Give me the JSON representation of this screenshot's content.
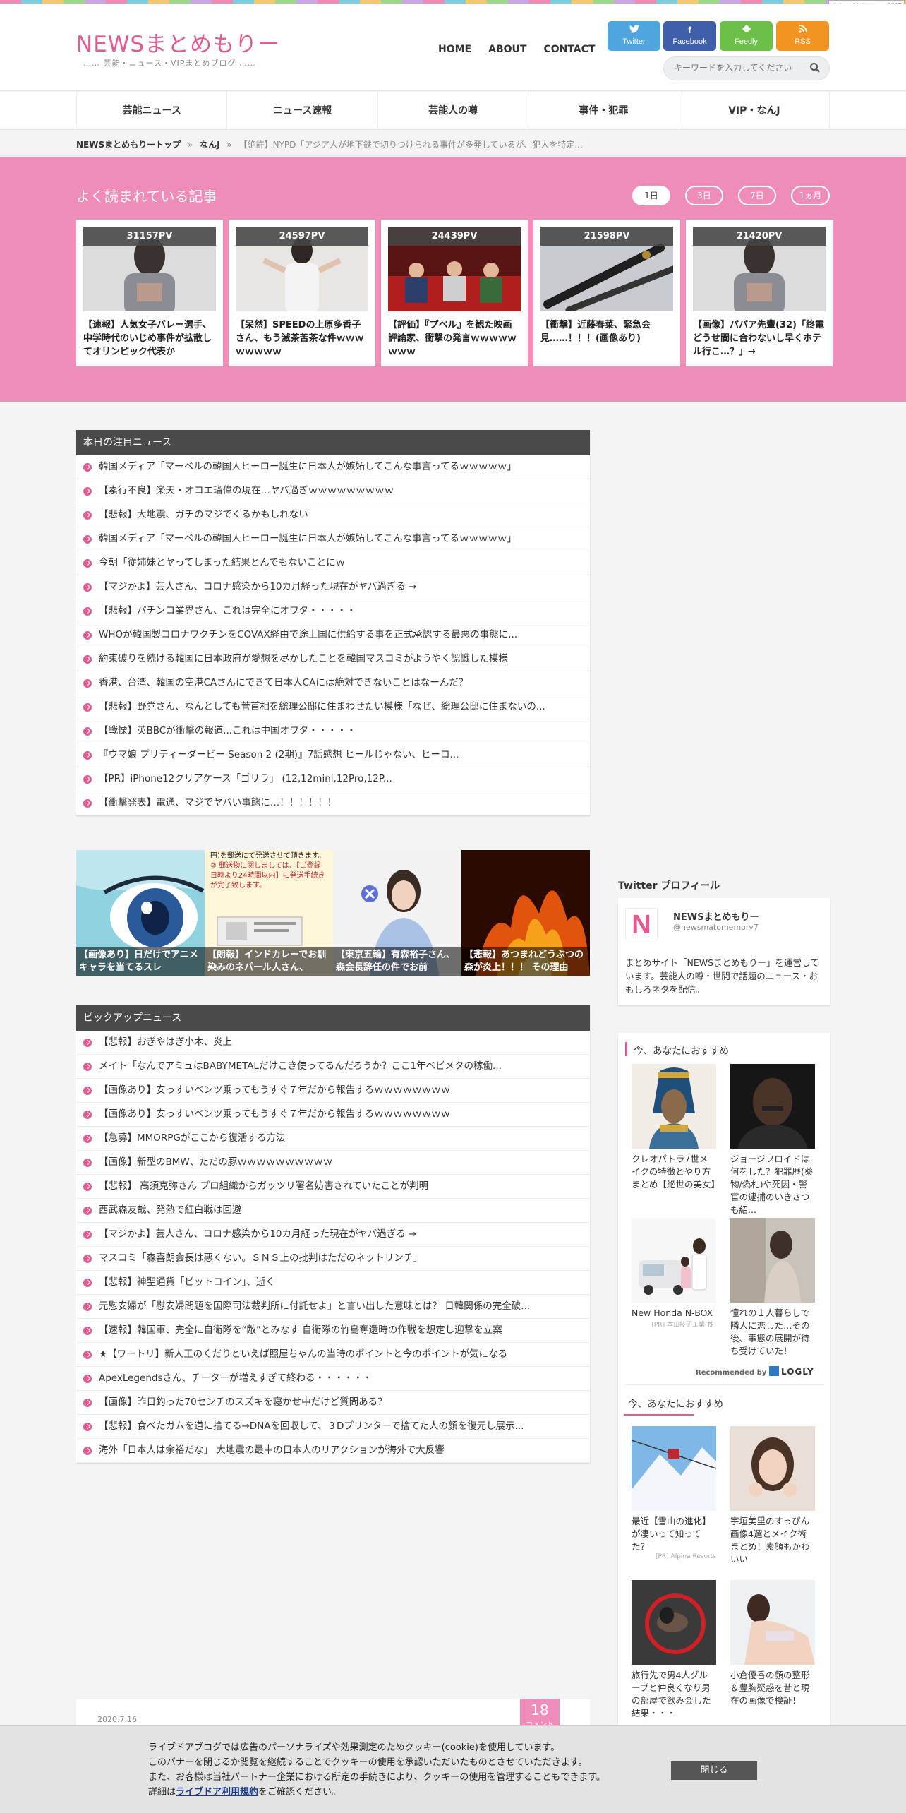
{
  "ad_badge": "人気の競馬サロン記録",
  "site": {
    "logo": "NEWSまとめもりー",
    "tagline": "…… 芸能・ニュース・VIPまとめブログ ……"
  },
  "topnav": [
    "HOME",
    "ABOUT",
    "CONTACT"
  ],
  "sns": [
    {
      "label": "Twitter",
      "color": "#4fa6df"
    },
    {
      "label": "Facebook",
      "color": "#3f5fa9"
    },
    {
      "label": "Feedly",
      "color": "#6dbf4a"
    },
    {
      "label": "RSS",
      "color": "#f39422"
    }
  ],
  "search": {
    "placeholder": "キーワードを入力してください"
  },
  "categories": [
    "芸能ニュース",
    "ニュース速報",
    "芸能人の噂",
    "事件・犯罪",
    "VIP・なんJ"
  ],
  "breadcrumb": {
    "home": "NEWSまとめもりートップ",
    "sep": "»",
    "cat": "なんJ",
    "current": "【絶許】NYPD「アジア人が地下鉄で切りつけられる事件が多発しているが、犯人を特定..."
  },
  "popular": {
    "title": "よく読まれている記事",
    "periods": [
      "1日",
      "3日",
      "7日",
      "1ヵ月"
    ],
    "items": [
      {
        "pv": "31157PV",
        "title": "【速報】人気女子バレー選手、中学時代のいじめ事件が拡散してオリンピック代表か"
      },
      {
        "pv": "24597PV",
        "title": "【呆然】SPEEDの上原多香子さん、もう滅茶苦茶な件ｗｗｗｗｗｗｗｗ"
      },
      {
        "pv": "24439PV",
        "title": "【評価】『プペル』を観た映画評論家、衝撃の発言ｗｗｗｗｗｗｗｗ"
      },
      {
        "pv": "21598PV",
        "title": "【衝撃】近藤春菜、緊急会見……！！！(画像あり)"
      },
      {
        "pv": "21420PV",
        "title": "【画像】パパア先輩(32)「終電どうせ間に合わないし早くホテル行こ…？」→"
      }
    ]
  },
  "notice": {
    "title": "本日の注目ニュース",
    "items": [
      "韓国メディア「マーベルの韓国人ヒーロー誕生に日本人が嫉妬してこんな事言ってるｗｗｗｗｗ」",
      "【素行不良】楽天・オコエ瑠偉の現在…ヤバ過ぎｗｗｗｗｗｗｗｗｗ",
      "【悲報】大地震、ガチのマジでくるかもしれない",
      "韓国メディア「マーベルの韓国人ヒーロー誕生に日本人が嫉妬してこんな事言ってるｗｗｗｗｗ」",
      "今朝「従姉妹とヤってしまった結果とんでもないことにｗ",
      "【マジかよ】芸人さん、コロナ感染から10カ月経った現在がヤバ過ぎる →",
      "【悲報】パチンコ業界さん、これは完全にオワタ・・・・・",
      "WHOが韓国製コロナワクチンをCOVAX経由で途上国に供給する事を正式承認する最悪の事態に...",
      "約束破りを続ける韓国に日本政府が愛想を尽かしたことを韓国マスコミがようやく認識した模様",
      "香港、台湾、韓国の空港CAさんにできて日本人CAには絶対できないことはなーんだ？",
      "【悲報】野党さん、なんとしても菅首相を総理公邸に住まわせたい模様「なぜ、総理公邸に住まないの...",
      "【戦慄】英BBCが衝撃の報道...これは中国オワタ・・・・・",
      "『ウマ娘 プリティーダービー Season 2 (2期)』7話感想 ヒールじゃない、ヒーロ...",
      "【PR】iPhone12クリアケース「ゴリラ」 (12,12mini,12Pro,12P...",
      "【衝撃発表】電通、マジでヤバい事態に…！！！！！！"
    ]
  },
  "thumbs": [
    "【画像あり】日だけでアニメキャラを当てるスレ",
    "【朗報】インドカレーでお馴染みのネパール人さん、",
    "【東京五輪】有森裕子さん、森会長辞任の件でお前",
    "【悲報】あつまれどうぶつの森が炎上！！！ その理由"
  ],
  "thumb_flyer": {
    "line1": "円)を郵送にて発送させて頂きます。",
    "line2": "② 郵送物に関しましては、【ご登録日時より24時間以内】に発送手続きが完了致します。"
  },
  "pickup": {
    "title": "ピックアップニュース",
    "items": [
      "【悲報】おぎやはぎ小木、炎上",
      "メイト「なんでアミュはBABYMETALだけこき使ってるんだろうか？ここ1年ベビメタの稼働...",
      "【画像あり】安っすいベンツ乗ってもうすぐ７年だから報告するｗｗｗｗｗｗｗｗ",
      "【画像あり】安っすいベンツ乗ってもうすぐ７年だから報告するｗｗｗｗｗｗｗｗ",
      "【急募】MMORPGがここから復活する方法",
      "【画像】新型のBMW、ただの豚ｗｗｗｗｗｗｗｗｗｗ",
      "【悲報】 高須克弥さん プロ組織からガッツリ署名妨害されていたことが判明",
      "西武森友哉、発熱で紅白戦は回避",
      "【マジかよ】芸人さん、コロナ感染から10カ月経った現在がヤバ過ぎる →",
      "マスコミ「森喜朗会長は悪くない。ＳＮＳ上の批判はただのネットリンチ」",
      "【悲報】神聖通貨「ビットコイン」、逝く",
      "元慰安婦が「慰安婦問題を国際司法裁判所に付託せよ」と言い出した意味とは？ 日韓関係の完全破...",
      "【速報】韓国軍、完全に自衛隊を“敵”とみなす 自衛隊の竹島奪還時の作戦を想定し迎撃を立案",
      "★【ワートリ】新人王のくだりといえば照屋ちゃんの当時のポイントと今のポイントが気になる",
      "ApexLegendsさん、チーターが増えすぎて終わる・・・・・・",
      "【画像】昨日釣った70センチのスズキを寝かせ中だけど質問ある？",
      "【悲報】食べたガムを道に捨てる→DNAを回収して、３Dプリンターで捨てた人の顔を復元し展示...",
      "海外「日本人は余裕だな」 大地震の最中の日本人のリアクションが海外で大反響"
    ]
  },
  "twitter_profile": {
    "section_title": "Twitter プロフィール",
    "avatar_letter": "N",
    "name": "NEWSまとめもりー",
    "handle": "@newsmatomemory7",
    "bio": "まとめサイト「NEWSまとめもりー」を運営しています。芸能人の噂・世間で話題のニュース・おもしろネタを配信。"
  },
  "recommend1": {
    "title": "今、あなたにおすすめ",
    "items": [
      {
        "title": "クレオパトラ7世メイクの特徴とやり方まとめ【絶世の美女】",
        "sponsor": ""
      },
      {
        "title": "ジョージフロイドは何をした？犯罪歴(薬物/偽札)や死因・警官の逮捕のいきさつも紹...",
        "sponsor": ""
      },
      {
        "title": "New Honda N-BOX",
        "sponsor": "[PR] 本田技研工業(株)"
      },
      {
        "title": "憧れの１人暮らしで隣人に恋した…その後、事態の展開が待ち受けていた！",
        "sponsor": ""
      }
    ],
    "recommended_by": "Recommended by",
    "brand": "LOGLY"
  },
  "recommend2": {
    "title": "今、あなたにおすすめ",
    "items": [
      {
        "title": "最近【雪山の進化】が凄いって知ってた？",
        "sponsor": "[PR] Alpina Resorts"
      },
      {
        "title": "宇垣美里のすっぴん画像4選とメイク術まとめ！素顔もかわいい",
        "sponsor": ""
      },
      {
        "title": "旅行先で男4人グループと仲良くなり男の部屋で飲み会した結果・・・",
        "sponsor": ""
      },
      {
        "title": "小倉優香の顔の整形＆豊胸疑惑を昔と現在の画像で検証！",
        "sponsor": ""
      }
    ]
  },
  "article": {
    "date": "2020.7.16",
    "comments": "18",
    "comment_label": "コメント"
  },
  "cookie": {
    "lines": [
      "ライブドアブログでは広告のパーソナライズや効果測定のためクッキー(cookie)を使用しています。",
      "このバナーを閉じるか閲覧を継続することでクッキーの使用を承認いただいたものとさせていただきます。",
      "また、お客様は当社パートナー企業における所定の手続きにより、クッキーの使用を管理することもできます。"
    ],
    "detail_prefix": "詳細は",
    "detail_link": "ライブドア利用規約",
    "detail_suffix": "をご確認ください。",
    "close": "閉じる"
  }
}
